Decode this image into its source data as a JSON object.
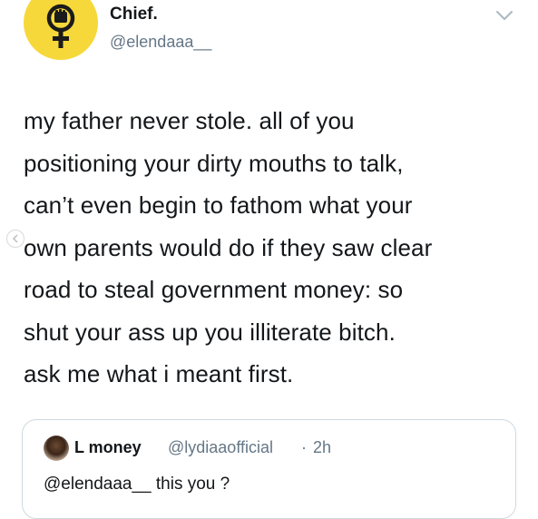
{
  "tweet": {
    "author_name": "Chief.",
    "author_handle": "@elendaaa__",
    "avatar_icon": "feminist-fist-symbol",
    "avatar_color": "#f6d83a",
    "menu_icon": "chevron-down-icon",
    "text": "my father never stole. all of you\npositioning your dirty mouths to talk,\ncan’t even begin to fathom what your\nown parents would do if they saw clear\nroad to steal government money: so\nshut your ass up you illiterate bitch.\nask me what i meant first."
  },
  "quoted_tweet": {
    "author_name": "L money",
    "author_handle": "@lydiaaofficial",
    "separator": "·",
    "time": "2h",
    "text": "@elendaaa__ this you ?"
  },
  "colors": {
    "text_primary": "#14171a",
    "text_secondary": "#657786",
    "border": "#cfd9de"
  }
}
